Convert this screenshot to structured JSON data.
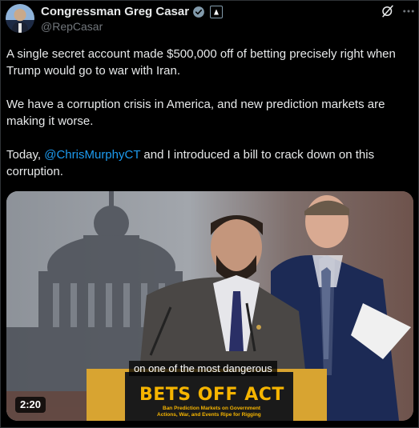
{
  "author": {
    "display_name": "Congressman Greg Casar",
    "handle": "@RepCasar"
  },
  "tweet": {
    "para1": "A single secret account made $500,000 off of betting precisely right when Trump would go to war with Iran.",
    "para2": "We have a corruption crisis in America, and new prediction markets are making it worse.",
    "para3_before": "Today, ",
    "para3_mention": "@ChrisMurphyCT",
    "para3_after": " and I introduced a bill to crack down on this corruption."
  },
  "video": {
    "caption": "on one of the most dangerous",
    "podium_title": "BETS OFF ACT",
    "podium_sub_line1": "Ban Prediction Markets on Government",
    "podium_sub_line2": "Actions, War, and Events Ripe for Rigging",
    "duration": "2:20"
  },
  "icons": {
    "verified": "verified-badge-icon",
    "government": "government-badge-icon",
    "grok": "grok-icon",
    "more": "more-icon"
  },
  "colors": {
    "background": "#000000",
    "text": "#e7e9ea",
    "secondary": "#71767b",
    "link": "#1d9bf0",
    "podium_gold": "#f5b400"
  }
}
